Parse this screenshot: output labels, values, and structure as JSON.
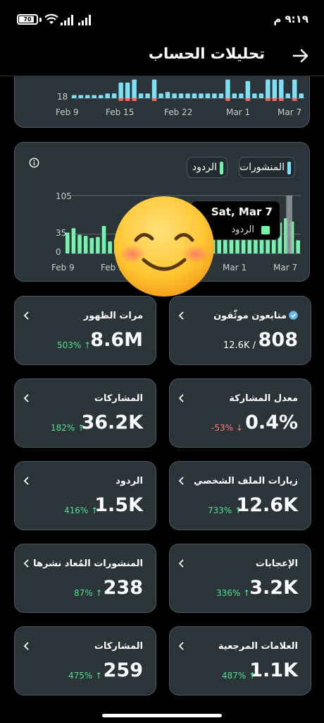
{
  "status_bar": {
    "time": "٩:١٩ م",
    "battery": "70"
  },
  "header": {
    "title": "تحليلات الحساب",
    "back_icon": "arrow-right-icon"
  },
  "chart_top": {
    "y_tick": "18",
    "x_labels": [
      "Feb 9",
      "Feb 15",
      "Feb 22",
      "Mar 1",
      "Mar 7"
    ]
  },
  "chart_main": {
    "legend": {
      "posts": "المنشورات",
      "replies": "الردود"
    },
    "y_ticks": [
      "105",
      "35",
      "0"
    ],
    "x_labels": [
      "Feb 9",
      "Feb 15",
      "Mar 1",
      "Mar 7"
    ],
    "tooltip": {
      "date": "Sat, Mar 7",
      "label": "الردود"
    },
    "colors": {
      "replies": "#77f2ad",
      "posts": "#7ee0f5",
      "highlight": "#9aa0a3"
    }
  },
  "chart_data": [
    {
      "type": "bar",
      "x_labels": [
        "Feb 9",
        "Feb 15",
        "Feb 22",
        "Mar 1",
        "Mar 7"
      ],
      "y_ticks": [
        "18"
      ],
      "series": [
        {
          "values": [
            2,
            2,
            2,
            2,
            2,
            3,
            3,
            10,
            10,
            12,
            3,
            3,
            12,
            3,
            4,
            3,
            3,
            3,
            3,
            3,
            3,
            3,
            3,
            12,
            3,
            3,
            11,
            3,
            3,
            12,
            12,
            12,
            3,
            12,
            3
          ]
        }
      ]
    },
    {
      "type": "bar",
      "x_labels": [
        "Feb 9",
        "Feb 15",
        "Mar 1",
        "Mar 7"
      ],
      "y_ticks": [
        "105",
        "35",
        "0"
      ],
      "ylim": [
        0,
        105
      ],
      "series": [
        {
          "name": "الردود",
          "values": [
            38,
            46,
            34,
            32,
            28,
            30,
            50,
            22,
            26,
            40,
            30,
            32,
            34,
            30,
            28,
            26,
            30,
            24,
            30,
            38,
            34,
            36,
            28,
            30,
            40,
            34,
            38,
            42,
            28,
            32,
            36,
            30,
            40,
            44,
            50,
            56,
            64,
            58,
            24
          ]
        }
      ]
    }
  ],
  "metrics": [
    {
      "id": "impressions",
      "title": "مرات الظهور",
      "value": "8.6M",
      "delta": "503% ↑",
      "dir": "up"
    },
    {
      "id": "verified_followers",
      "title": "متابعون موثّقون",
      "value": "808",
      "sub": "12.6K /"
    },
    {
      "id": "shares",
      "title": "المشاركات",
      "value": "36.2K",
      "delta": "182% ↑",
      "dir": "up"
    },
    {
      "id": "engagement_rate",
      "title": "معدل المشاركة",
      "value": "0.4%",
      "delta": "-53% ↓",
      "dir": "down"
    },
    {
      "id": "replies",
      "title": "الردود",
      "value": "1.5K",
      "delta": "416% ↑",
      "dir": "up"
    },
    {
      "id": "profile_visits",
      "title": "زيارات الملف الشخصي",
      "value": "12.6K",
      "delta": "733% ↑",
      "dir": "up"
    },
    {
      "id": "reposts",
      "title": "المنشورات المُعاد نشرها",
      "value": "238",
      "delta": "87% ↑",
      "dir": "up"
    },
    {
      "id": "likes",
      "title": "الإعجابات",
      "value": "3.2K",
      "delta": "336% ↑",
      "dir": "up"
    },
    {
      "id": "shares_2",
      "title": "المشاركات",
      "value": "259",
      "delta": "475% ↑",
      "dir": "up"
    },
    {
      "id": "bookmarks",
      "title": "العلامات المرجعية",
      "value": "1.1K",
      "delta": "487% ↑",
      "dir": "up"
    }
  ]
}
